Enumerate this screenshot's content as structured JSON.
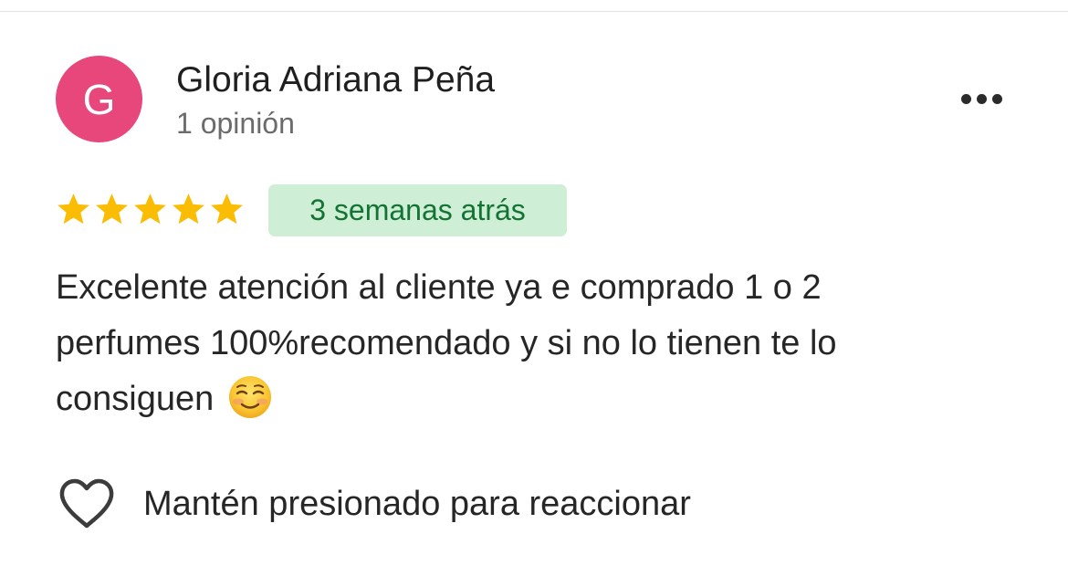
{
  "review": {
    "author": {
      "initial": "G",
      "name": "Gloria Adriana Peña",
      "review_count": "1 opinión",
      "avatar_color": "#e8477c"
    },
    "more_icon": "more-horizontal-icon",
    "rating": 5,
    "rating_max": 5,
    "star_color": "#fbbc04",
    "date_label": "3 semanas atrás",
    "date_badge_bg": "#cfeed6",
    "date_badge_text_color": "#137333",
    "text_line1": "Excelente atención al cliente ya e comprado 1 o 2",
    "text_line2": "perfumes 100%recomendado y si no lo tienen te lo",
    "text_line3": "consiguen",
    "emoji": "☺️",
    "reaction": {
      "icon": "heart-outline-icon",
      "label": "Mantén presionado para reaccionar"
    }
  }
}
